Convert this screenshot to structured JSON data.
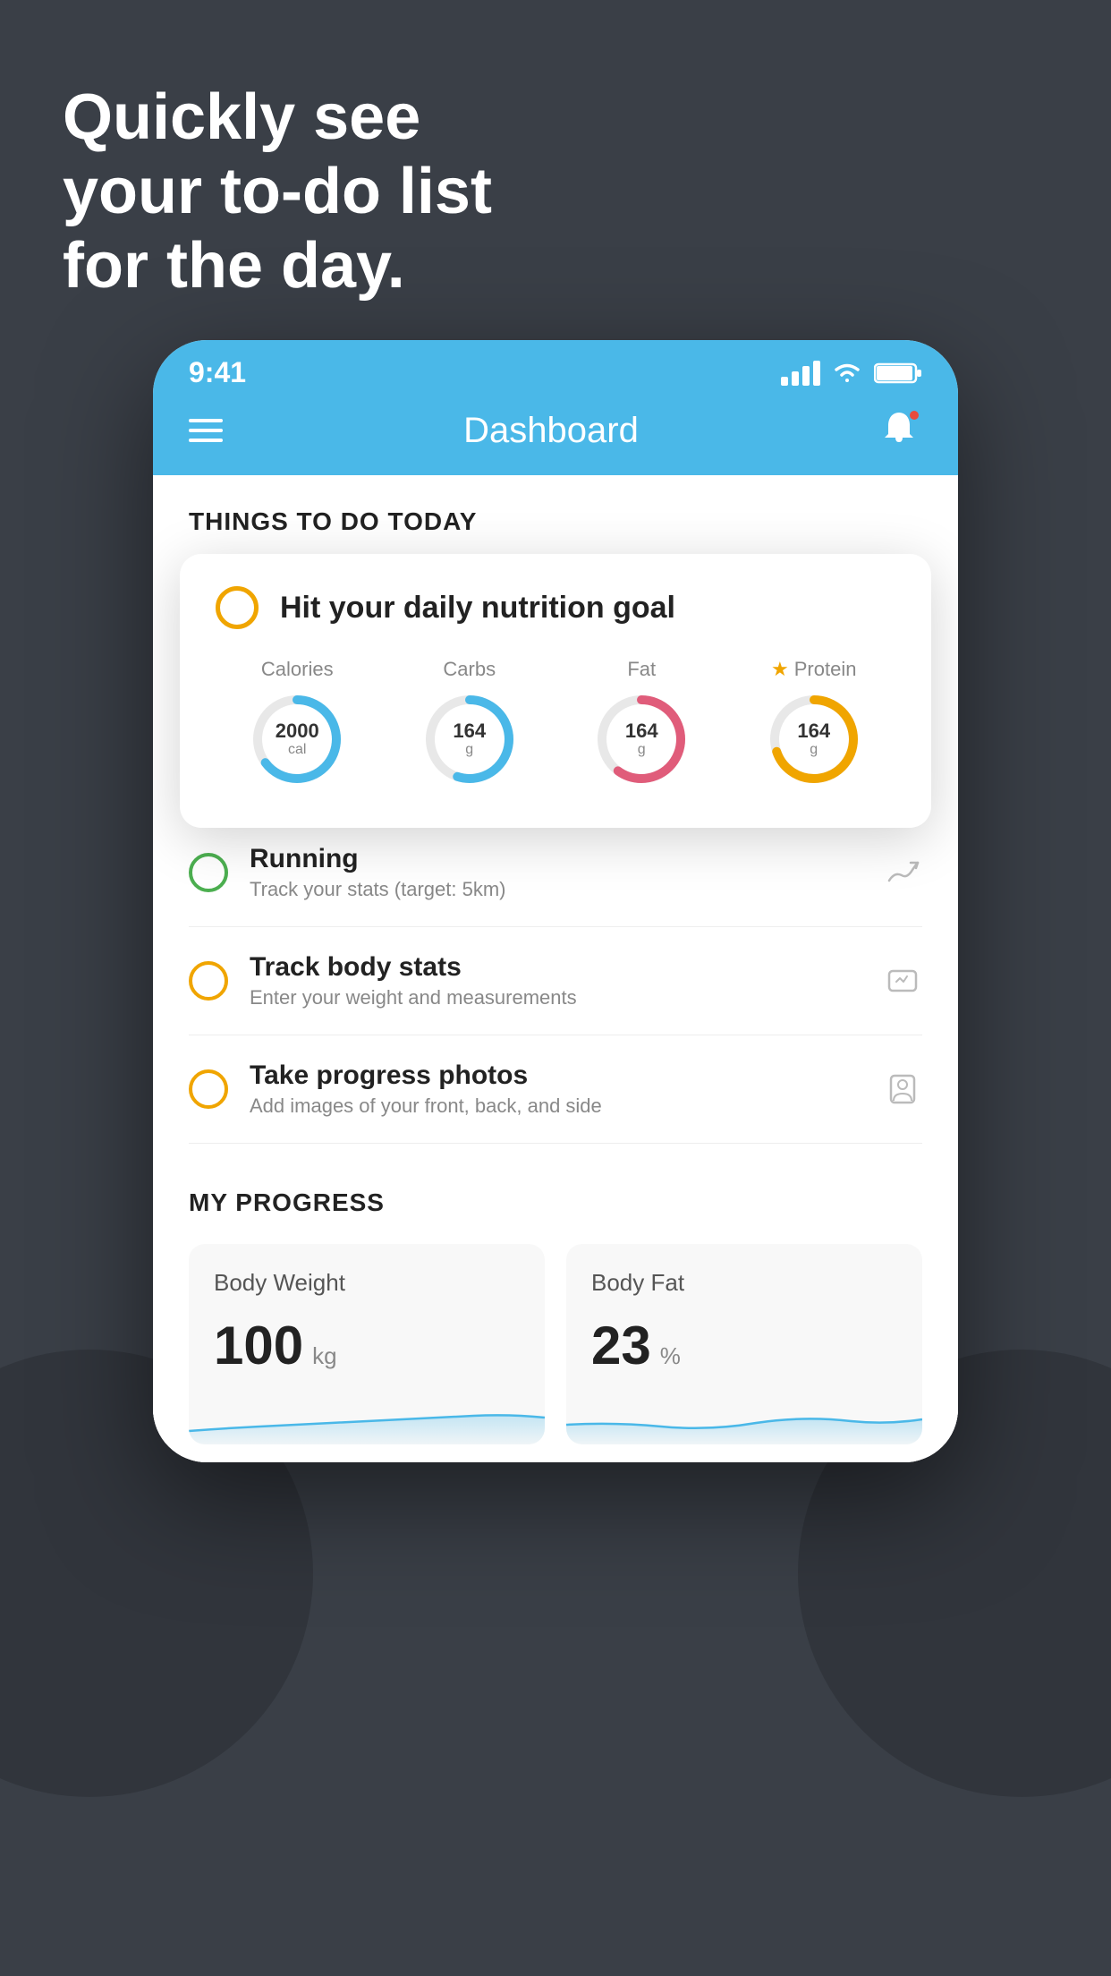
{
  "headline": {
    "line1": "Quickly see",
    "line2": "your to-do list",
    "line3": "for the day."
  },
  "phone": {
    "status": {
      "time": "9:41"
    },
    "navbar": {
      "title": "Dashboard"
    },
    "things_heading": "THINGS TO DO TODAY",
    "nutrition_card": {
      "check_type": "empty",
      "title": "Hit your daily nutrition goal",
      "macros": [
        {
          "label": "Calories",
          "value": "2000",
          "unit": "cal",
          "color": "#4ab8e8",
          "percent": 65
        },
        {
          "label": "Carbs",
          "value": "164",
          "unit": "g",
          "color": "#4ab8e8",
          "percent": 55
        },
        {
          "label": "Fat",
          "value": "164",
          "unit": "g",
          "color": "#e05c7a",
          "percent": 60
        },
        {
          "label": "Protein",
          "value": "164",
          "unit": "g",
          "color": "#f0a500",
          "percent": 70,
          "starred": true
        }
      ]
    },
    "todo_items": [
      {
        "circle_color": "green",
        "title": "Running",
        "subtitle": "Track your stats (target: 5km)",
        "icon": "shoe"
      },
      {
        "circle_color": "yellow",
        "title": "Track body stats",
        "subtitle": "Enter your weight and measurements",
        "icon": "scale"
      },
      {
        "circle_color": "yellow",
        "title": "Take progress photos",
        "subtitle": "Add images of your front, back, and side",
        "icon": "person"
      }
    ],
    "progress": {
      "heading": "MY PROGRESS",
      "cards": [
        {
          "title": "Body Weight",
          "value": "100",
          "unit": "kg"
        },
        {
          "title": "Body Fat",
          "value": "23",
          "unit": "%"
        }
      ]
    }
  }
}
